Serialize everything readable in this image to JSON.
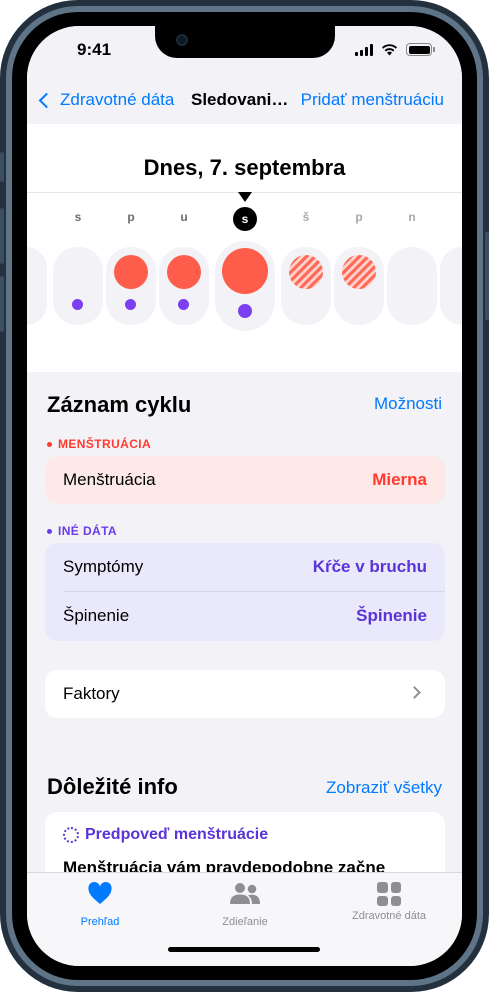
{
  "status_bar": {
    "time": "9:41"
  },
  "nav": {
    "back_label": "Zdravotné dáta",
    "title": "Sledovanie cyklu",
    "action_label": "Pridať menštruáciu"
  },
  "calendar": {
    "date_title": "Dnes, 7. septembra",
    "day_letters": [
      "s",
      "p",
      "u",
      "s",
      "š",
      "p",
      "n"
    ],
    "today_index": 3
  },
  "cycle_log": {
    "title": "Záznam cyklu",
    "options_label": "Možnosti",
    "menstruation_category": "MENŠTRUÁCIA",
    "menstruation_row": {
      "label": "Menštruácia",
      "value": "Mierna"
    },
    "other_category": "INÉ DÁTA",
    "symptoms_row": {
      "label": "Symptómy",
      "value": "Kŕče v bruchu"
    },
    "spotting_row": {
      "label": "Špinenie",
      "value": "Špinenie"
    },
    "factors_row": {
      "label": "Faktory"
    }
  },
  "important_info": {
    "title": "Dôležité info",
    "show_all_label": "Zobraziť všetky",
    "prediction_title": "Predpoveď menštruácie",
    "prediction_body": "Menštruácia vám pravdepodobne začne"
  },
  "tabbar": {
    "tabs": [
      {
        "label": "Prehľad",
        "active": true
      },
      {
        "label": "Zdieľanie",
        "active": false
      },
      {
        "label": "Zdravotné dáta",
        "active": false
      }
    ]
  },
  "colors": {
    "accent": "#007aff",
    "menstruation": "#ff5d4b",
    "other_data": "#7b3fef",
    "background": "#f2f2f7"
  }
}
